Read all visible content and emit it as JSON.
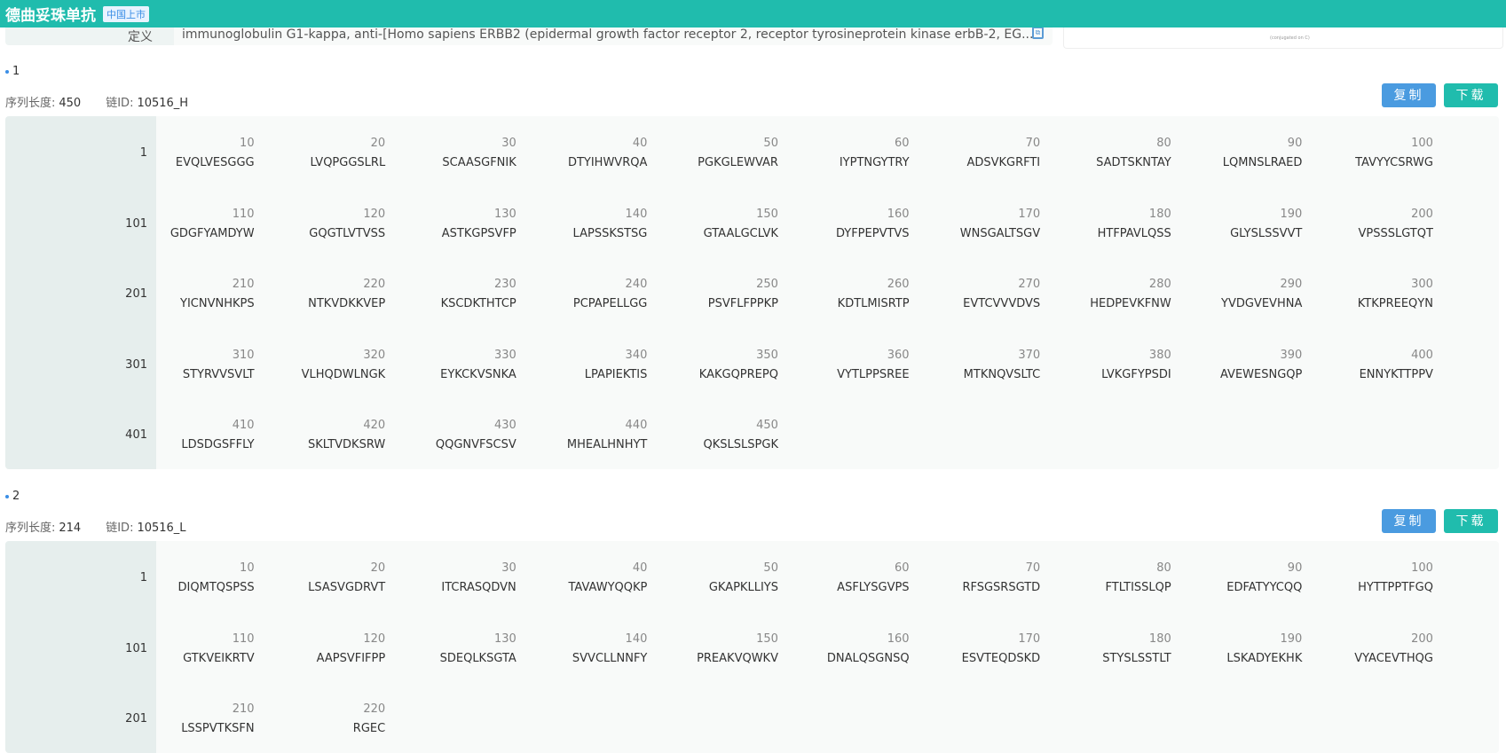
{
  "header": {
    "title": "德曲妥珠单抗",
    "badge": "中国上市"
  },
  "definition": {
    "label": "定义",
    "value": "immunoglobulin G1-kappa, anti-[Homo sapiens ERBB2 (epidermal growth factor receptor 2, receptor tyrosineprotein kinase erbB-2, EG...",
    "structure_caption": "(conjugated on C)"
  },
  "labels": {
    "length": "序列长度:",
    "chain_id": "链ID:",
    "copy": "复制",
    "download": "下载"
  },
  "chains": [
    {
      "index": "1",
      "length": "450",
      "chain_id": "10516_H",
      "rows": [
        {
          "start": "1",
          "cells": [
            [
              "10",
              "EVQLVESGGG"
            ],
            [
              "20",
              "LVQPGGSLRL"
            ],
            [
              "30",
              "SCAASGFNIK"
            ],
            [
              "40",
              "DTYIHWVRQA"
            ],
            [
              "50",
              "PGKGLEWVAR"
            ],
            [
              "60",
              "IYPTNGYTRY"
            ],
            [
              "70",
              "ADSVKGRFTI"
            ],
            [
              "80",
              "SADTSKNTAY"
            ],
            [
              "90",
              "LQMNSLRAED"
            ],
            [
              "100",
              "TAVYYCSRWG"
            ]
          ]
        },
        {
          "start": "101",
          "cells": [
            [
              "110",
              "GDGFYAMDYW"
            ],
            [
              "120",
              "GQGTLVTVSS"
            ],
            [
              "130",
              "ASTKGPSVFP"
            ],
            [
              "140",
              "LAPSSKSTSG"
            ],
            [
              "150",
              "GTAALGCLVK"
            ],
            [
              "160",
              "DYFPEPVTVS"
            ],
            [
              "170",
              "WNSGALTSGV"
            ],
            [
              "180",
              "HTFPAVLQSS"
            ],
            [
              "190",
              "GLYSLSSVVT"
            ],
            [
              "200",
              "VPSSSLGTQT"
            ]
          ]
        },
        {
          "start": "201",
          "cells": [
            [
              "210",
              "YICNVNHKPS"
            ],
            [
              "220",
              "NTKVDKKVEP"
            ],
            [
              "230",
              "KSCDKTHTCP"
            ],
            [
              "240",
              "PCPAPELLGG"
            ],
            [
              "250",
              "PSVFLFPPKP"
            ],
            [
              "260",
              "KDTLMISRTP"
            ],
            [
              "270",
              "EVTCVVVDVS"
            ],
            [
              "280",
              "HEDPEVKFNW"
            ],
            [
              "290",
              "YVDGVEVHNA"
            ],
            [
              "300",
              "KTKPREEQYN"
            ]
          ]
        },
        {
          "start": "301",
          "cells": [
            [
              "310",
              "STYRVVSVLT"
            ],
            [
              "320",
              "VLHQDWLNGK"
            ],
            [
              "330",
              "EYKCKVSNKA"
            ],
            [
              "340",
              "LPAPIEKTIS"
            ],
            [
              "350",
              "KAKGQPREPQ"
            ],
            [
              "360",
              "VYTLPPSREE"
            ],
            [
              "370",
              "MTKNQVSLTC"
            ],
            [
              "380",
              "LVKGFYPSDI"
            ],
            [
              "390",
              "AVEWESNGQP"
            ],
            [
              "400",
              "ENNYKTTPPV"
            ]
          ]
        },
        {
          "start": "401",
          "cells": [
            [
              "410",
              "LDSDGSFFLY"
            ],
            [
              "420",
              "SKLTVDKSRW"
            ],
            [
              "430",
              "QQGNVFSCSV"
            ],
            [
              "440",
              "MHEALHNHYT"
            ],
            [
              "450",
              "QKSLSLSPGK"
            ]
          ]
        }
      ]
    },
    {
      "index": "2",
      "length": "214",
      "chain_id": "10516_L",
      "rows": [
        {
          "start": "1",
          "cells": [
            [
              "10",
              "DIQMTQSPSS"
            ],
            [
              "20",
              "LSASVGDRVT"
            ],
            [
              "30",
              "ITCRASQDVN"
            ],
            [
              "40",
              "TAVAWYQQKP"
            ],
            [
              "50",
              "GKAPKLLIYS"
            ],
            [
              "60",
              "ASFLYSGVPS"
            ],
            [
              "70",
              "RFSGSRSGTD"
            ],
            [
              "80",
              "FTLTISSLQP"
            ],
            [
              "90",
              "EDFATYYCQQ"
            ],
            [
              "100",
              "HYTTPPTFGQ"
            ]
          ]
        },
        {
          "start": "101",
          "cells": [
            [
              "110",
              "GTKVEIKRTV"
            ],
            [
              "120",
              "AAPSVFIFPP"
            ],
            [
              "130",
              "SDEQLKSGTA"
            ],
            [
              "140",
              "SVVCLLNNFY"
            ],
            [
              "150",
              "PREAKVQWKV"
            ],
            [
              "160",
              "DNALQSGNSQ"
            ],
            [
              "170",
              "ESVTEQDSKD"
            ],
            [
              "180",
              "STYSLSSTLT"
            ],
            [
              "190",
              "LSKADYEKHK"
            ],
            [
              "200",
              "VYACEVTHQG"
            ]
          ]
        },
        {
          "start": "201",
          "cells": [
            [
              "210",
              "LSSPVTKSFN"
            ],
            [
              "220",
              "RGEC"
            ]
          ]
        }
      ]
    }
  ]
}
